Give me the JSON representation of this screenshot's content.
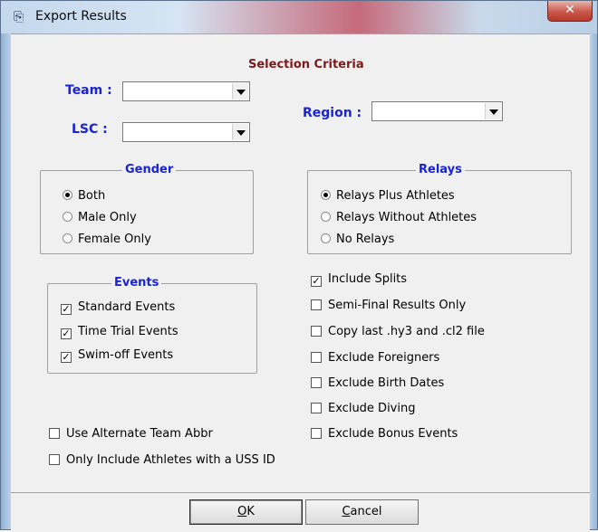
{
  "window": {
    "title": "Export Results",
    "close_glyph": "✕"
  },
  "selection_criteria": "Selection Criteria",
  "filters": {
    "team": {
      "label": "Team :",
      "value": ""
    },
    "lsc": {
      "label": "LSC :",
      "value": ""
    },
    "region": {
      "label": "Region :",
      "value": ""
    }
  },
  "gender": {
    "title": "Gender",
    "options": [
      {
        "label": "Both",
        "selected": true
      },
      {
        "label": "Male Only",
        "selected": false
      },
      {
        "label": "Female Only",
        "selected": false
      }
    ]
  },
  "relays": {
    "title": "Relays",
    "options": [
      {
        "label": "Relays Plus Athletes",
        "selected": true
      },
      {
        "label": "Relays Without Athletes",
        "selected": false
      },
      {
        "label": "No Relays",
        "selected": false
      }
    ]
  },
  "events": {
    "title": "Events",
    "options": [
      {
        "label": "Standard Events",
        "checked": true
      },
      {
        "label": "Time Trial Events",
        "checked": true
      },
      {
        "label": "Swim-off Events",
        "checked": true
      }
    ]
  },
  "right_options": [
    {
      "label": "Include Splits",
      "checked": true
    },
    {
      "label": "Semi-Final Results Only",
      "checked": false
    },
    {
      "label": "Copy last .hy3 and .cl2 file",
      "checked": false
    },
    {
      "label": "Exclude Foreigners",
      "checked": false
    },
    {
      "label": "Exclude Birth Dates",
      "checked": false
    },
    {
      "label": "Exclude Diving",
      "checked": false
    },
    {
      "label": "Exclude Bonus Events",
      "checked": false
    }
  ],
  "left_options": [
    {
      "label": "Use Alternate Team Abbr",
      "checked": false
    },
    {
      "label": "Only Include Athletes with a USS ID",
      "checked": false
    }
  ],
  "buttons": {
    "ok": {
      "mnemonic": "O",
      "rest": "K"
    },
    "cancel": {
      "mnemonic": "C",
      "rest": "ancel"
    }
  }
}
